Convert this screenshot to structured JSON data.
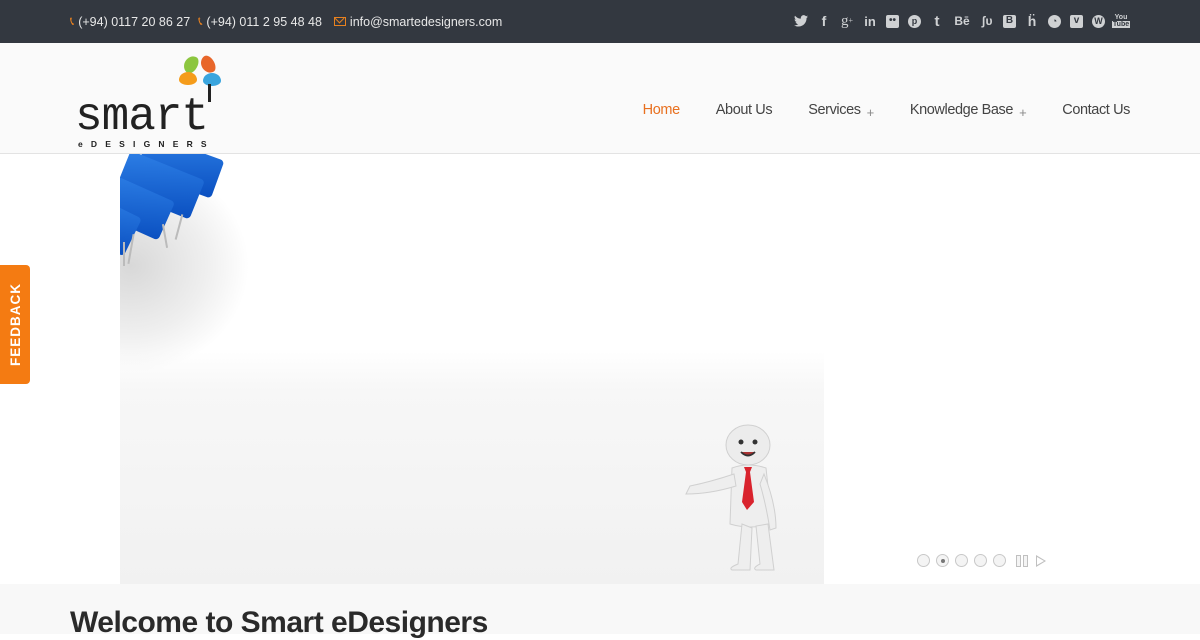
{
  "topbar": {
    "phone1": "(+94) 0117 20 86 27",
    "phone2": "(+94) 011 2 95 48 48",
    "email": "info@smartedesigners.com",
    "social": [
      {
        "name": "twitter-icon",
        "glyph": "🐦"
      },
      {
        "name": "facebook-icon",
        "glyph": "f"
      },
      {
        "name": "google-plus-icon",
        "glyph": "g+"
      },
      {
        "name": "linkedin-icon",
        "glyph": "in"
      },
      {
        "name": "flickr-icon",
        "glyph": "••"
      },
      {
        "name": "pinterest-icon",
        "glyph": "p"
      },
      {
        "name": "tumblr-icon",
        "glyph": "t"
      },
      {
        "name": "behance-icon",
        "glyph": "Bē"
      },
      {
        "name": "stumbleupon-icon",
        "glyph": "ʃυ"
      },
      {
        "name": "blogger-icon",
        "glyph": "B"
      },
      {
        "name": "hi5-icon",
        "glyph": "ḧ"
      },
      {
        "name": "picasa-icon",
        "glyph": "◔"
      },
      {
        "name": "vimeo-icon",
        "glyph": "v"
      },
      {
        "name": "wordpress-icon",
        "glyph": "W"
      },
      {
        "name": "youtube-icon",
        "glyph": "▶"
      }
    ]
  },
  "logo": {
    "word": "smart",
    "sub": "eDESIGNERS"
  },
  "nav": {
    "items": [
      {
        "label": "Home",
        "active": true
      },
      {
        "label": "About Us"
      },
      {
        "label": "Services",
        "plus": "+"
      },
      {
        "label": "Knowledge Base",
        "plus": "+"
      },
      {
        "label": "Contact Us"
      }
    ]
  },
  "feedback": {
    "label": "FEEDBACK"
  },
  "slider": {
    "slide_count": 5,
    "active_slide": 2
  },
  "main": {
    "welcome_title": "Welcome to Smart eDesigners"
  },
  "colors": {
    "accent": "#e8701f",
    "topbar_bg": "#333840",
    "feedback_bg": "#f47b12"
  }
}
